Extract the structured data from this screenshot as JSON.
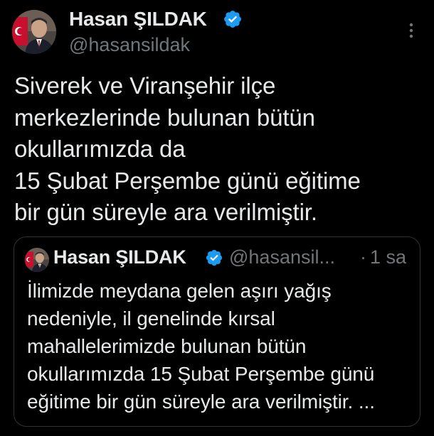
{
  "author": {
    "name": "Hasan ŞILDAK",
    "handle": "@hasansildak"
  },
  "tweet": {
    "lines": [
      "Siverek ve Viranşehir ilçe",
      "merkezlerinde bulunan bütün",
      "okullarımızda da",
      "15 Şubat Perşembe günü eğitime",
      "bir gün süreyle ara verilmiştir."
    ]
  },
  "quoted_tweet": {
    "name": "Hasan ŞILDAK",
    "handle": "@hasansil...",
    "separator": "·",
    "time": "1 sa",
    "lines": [
      "İlimizde meydana gelen aşırı yağış",
      "nedeniyle, il genelinde kırsal",
      "mahallelerimizde bulunan bütün",
      "okullarımızda 15 Şubat Perşembe günü",
      "eğitime bir gün süreyle ara verilmiştir. ..."
    ]
  },
  "icons": {
    "avatar": "profile-photo-avatar",
    "verified": "verified-badge-icon",
    "more": "more-options-icon"
  },
  "colors": {
    "background": "#000000",
    "text_primary": "#e7e9ea",
    "text_secondary": "#71767b",
    "verified_blue": "#1d9bf0",
    "border": "#2f3336"
  }
}
